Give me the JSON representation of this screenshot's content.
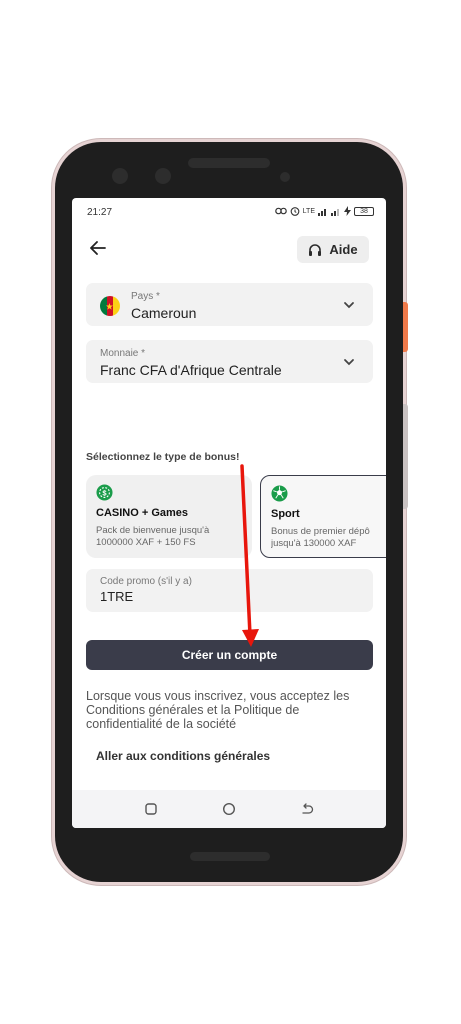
{
  "status_bar": {
    "time": "21:27",
    "network": "LTE",
    "battery": "38"
  },
  "header": {
    "help_label": "Aide"
  },
  "country_field": {
    "label": "Pays *",
    "value": "Cameroun",
    "flag_colors": [
      "#007a3d",
      "#ce1126",
      "#fcd116"
    ]
  },
  "currency_field": {
    "label": "Monnaie *",
    "value": "Franc CFA d'Afrique Centrale"
  },
  "bonus_section": {
    "title": "Sélectionnez le type de bonus!",
    "options": [
      {
        "icon": "casino-chip-icon",
        "title": "CASINO + Games",
        "desc_line1": "Pack de bienvenue jusqu'à",
        "desc_line2": "1000000 XAF + 150 FS",
        "selected": false
      },
      {
        "icon": "soccer-ball-icon",
        "title": "Sport",
        "desc_line1": "Bonus de premier dépô",
        "desc_line2": "jusqu'à 130000 XAF",
        "selected": true
      }
    ]
  },
  "promo_field": {
    "label": "Code promo (s'il y a)",
    "value": "1TRE"
  },
  "create_button": {
    "label": "Créer un compte"
  },
  "legal_text": "Lorsque vous vous inscrivez, vous acceptez les Conditions générales et la Politique de confidentialité de la société",
  "terms_link": "Aller aux conditions générales",
  "colors": {
    "accent_green": "#1a9c4a",
    "button_dark": "#3a3c4a",
    "annotation_red": "#e8160c"
  }
}
